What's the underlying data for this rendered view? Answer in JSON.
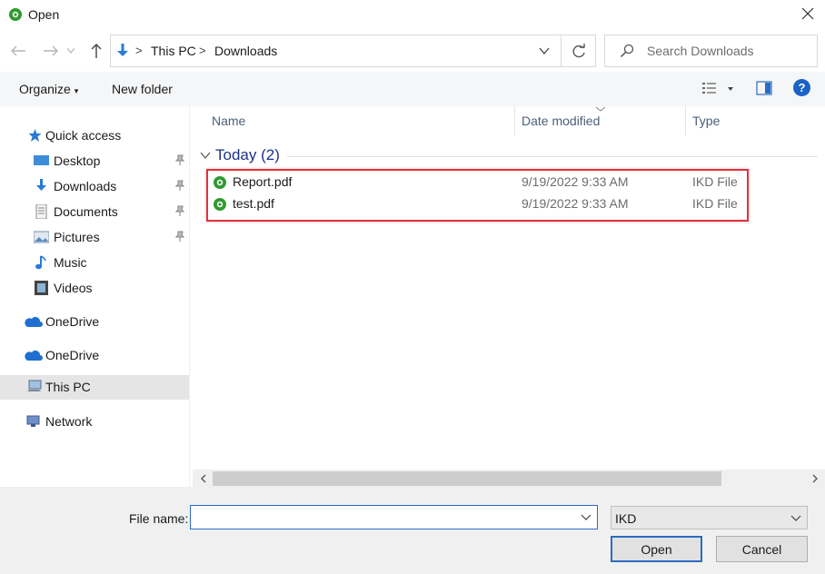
{
  "window": {
    "title": "Open"
  },
  "navigation": {
    "breadcrumb": [
      "This PC",
      "Downloads"
    ],
    "search_placeholder": "Search Downloads"
  },
  "toolbar": {
    "organize_label": "Organize",
    "new_folder_label": "New folder",
    "help_label": "?"
  },
  "sidebar": {
    "quick_access_label": "Quick access",
    "quick_items": [
      {
        "label": "Desktop",
        "icon": "desktop-icon",
        "pinned": true
      },
      {
        "label": "Downloads",
        "icon": "downloads-icon",
        "pinned": true
      },
      {
        "label": "Documents",
        "icon": "documents-icon",
        "pinned": true
      },
      {
        "label": "Pictures",
        "icon": "pictures-icon",
        "pinned": true
      },
      {
        "label": "Music",
        "icon": "music-icon",
        "pinned": false
      },
      {
        "label": "Videos",
        "icon": "videos-icon",
        "pinned": false
      }
    ],
    "locations": [
      {
        "label": "OneDrive",
        "icon": "onedrive-icon"
      },
      {
        "label": "OneDrive",
        "icon": "onedrive-icon"
      },
      {
        "label": "This PC",
        "icon": "this-pc-icon",
        "selected": true
      },
      {
        "label": "Network",
        "icon": "network-icon"
      }
    ]
  },
  "file_list": {
    "columns": [
      "Name",
      "Date modified",
      "Type"
    ],
    "group_label": "Today (2)",
    "files": [
      {
        "name": "Report.pdf",
        "date_modified": "9/19/2022 9:33 AM",
        "type": "IKD File",
        "icon": "ikd-file-icon"
      },
      {
        "name": "test.pdf",
        "date_modified": "9/19/2022 9:33 AM",
        "type": "IKD File",
        "icon": "ikd-file-icon"
      }
    ]
  },
  "footer": {
    "file_name_label": "File name:",
    "file_name_value": "",
    "file_type_selected": "IKD",
    "open_label": "Open",
    "cancel_label": "Cancel"
  },
  "colors": {
    "accent": "#2b6cc4",
    "group_heading": "#1e3287",
    "highlight_border": "#e0313c",
    "app_icon_green": "#2f9a2f"
  }
}
